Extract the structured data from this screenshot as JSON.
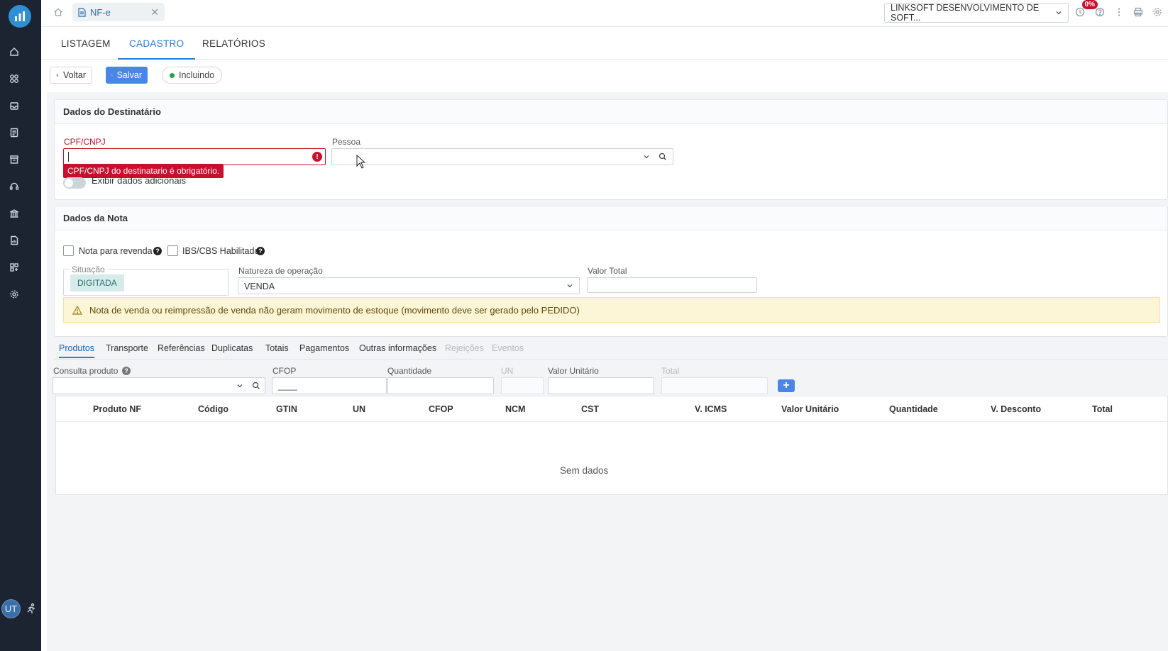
{
  "topbar": {
    "doc_tab": "NF-e",
    "company": "LINKSOFT DESENVOLVIMENTO DE SOFT...",
    "badge": "0%"
  },
  "user": {
    "initials": "UT"
  },
  "nav": {
    "tabs": [
      {
        "label": "LISTAGEM",
        "active": false
      },
      {
        "label": "CADASTRO",
        "active": true
      },
      {
        "label": "RELATÓRIOS",
        "active": false
      }
    ]
  },
  "toolbar": {
    "back_label": "Voltar",
    "save_label": "Salvar",
    "status_label": "Incluindo"
  },
  "destinatario": {
    "title": "Dados do Destinatário",
    "cpf_label": "CPF/CNPJ",
    "cpf_value": "",
    "cpf_error": "CPF/CNPJ do destinatario é obrigatório.",
    "pessoa_label": "Pessoa",
    "pessoa_value": "",
    "toggle_label": "Exibir dados adicionais",
    "toggle_on": false
  },
  "nota": {
    "title": "Dados da Nota",
    "revenda_label": "Nota para revenda",
    "revenda_checked": false,
    "ibs_label": "IBS/CBS Habilitado",
    "ibs_checked": false,
    "situacao_label": "Situação",
    "situacao_value": "DIGITADA",
    "natureza_label": "Natureza de operação",
    "natureza_value": "VENDA",
    "valor_total_label": "Valor Total",
    "valor_total_value": "",
    "alert": "Nota de venda ou reimpressão de venda não geram movimento de estoque (movimento deve ser gerado pelo PEDIDO)"
  },
  "subtabs": [
    {
      "label": "Produtos",
      "state": "active"
    },
    {
      "label": "Transporte",
      "state": "normal"
    },
    {
      "label": "Referências",
      "state": "normal"
    },
    {
      "label": "Duplicatas",
      "state": "normal"
    },
    {
      "label": "Totais",
      "state": "normal"
    },
    {
      "label": "Pagamentos",
      "state": "normal"
    },
    {
      "label": "Outras informações",
      "state": "normal"
    },
    {
      "label": "Rejeições",
      "state": "disabled"
    },
    {
      "label": "Eventos",
      "state": "disabled"
    }
  ],
  "produto_form": {
    "consulta_label": "Consulta produto",
    "cfop_label": "CFOP",
    "cfop_value": "____",
    "quantidade_label": "Quantidade",
    "un_label": "UN",
    "valor_unitario_label": "Valor Unitário",
    "total_label": "Total"
  },
  "grid": {
    "columns": [
      "Produto NF",
      "Código",
      "GTIN",
      "UN",
      "CFOP",
      "NCM",
      "CST",
      "V. ICMS",
      "Valor Unitário",
      "Quantidade",
      "V. Desconto",
      "Total"
    ],
    "rows": [],
    "empty_text": "Sem dados"
  },
  "colors": {
    "sidebar_bg": "#1b2430",
    "accent": "#2b7ed6",
    "error": "#c8102e",
    "success": "#24a148"
  }
}
